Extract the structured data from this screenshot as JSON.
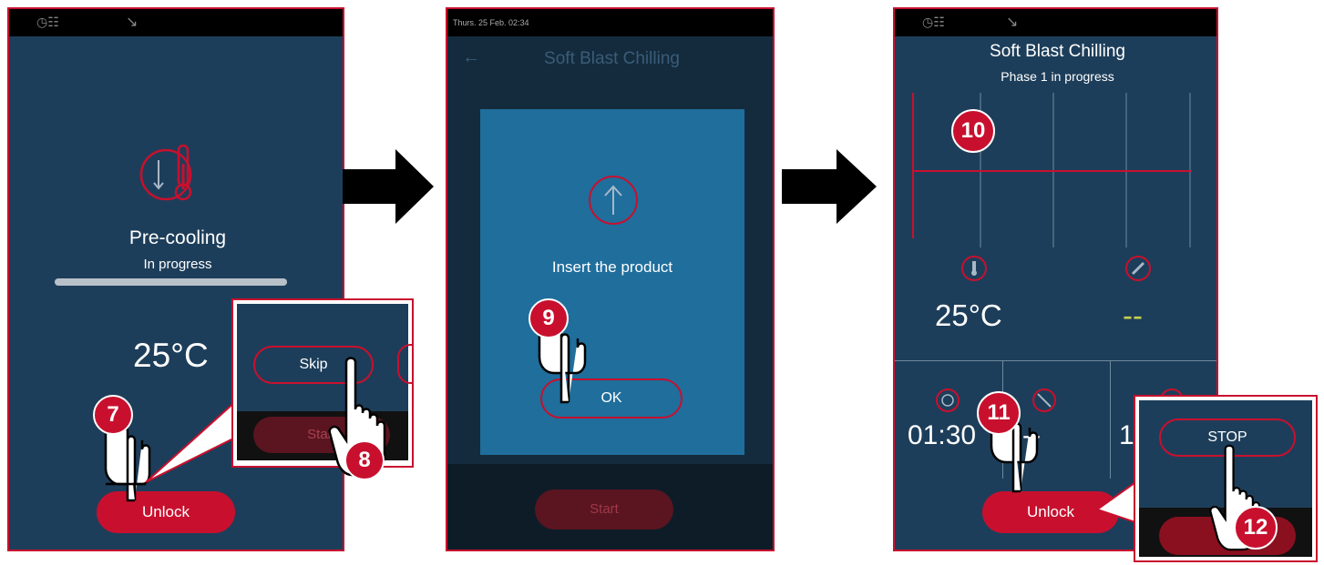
{
  "panel1": {
    "status_icons": "◷☷",
    "wifi_icon": "↘",
    "title": "Pre-cooling",
    "subtitle": "In progress",
    "temperature": "25°C",
    "unlock_label": "Unlock",
    "step_7": "7",
    "progress": 1.0
  },
  "zoom1": {
    "skip_label": "Skip",
    "start_label": "Start",
    "step_8": "8"
  },
  "panel2": {
    "datetime": "Thurs. 25 Feb. 02:34",
    "title": "Soft Blast Chilling",
    "dialog_message": "Insert the product",
    "ok_label": "OK",
    "start_label": "Start",
    "step_9": "9"
  },
  "panel3": {
    "status_icons": "◷☷",
    "wifi_icon": "↘",
    "title": "Soft Blast Chilling",
    "subtitle": "Phase 1 in progress",
    "temperature": "25°C",
    "probe_value": "--",
    "time_value": "01:30",
    "dash_value": "--",
    "partial_value": "1",
    "unlock_label": "Unlock",
    "step_10": "10",
    "step_11": "11"
  },
  "zoom2": {
    "stop_label": "STOP",
    "start_label": "S",
    "step_12": "12"
  },
  "colors": {
    "panel_bg": "#1d3e5a",
    "accent": "#c8102e",
    "dialog_bg": "#1f6e9c"
  }
}
